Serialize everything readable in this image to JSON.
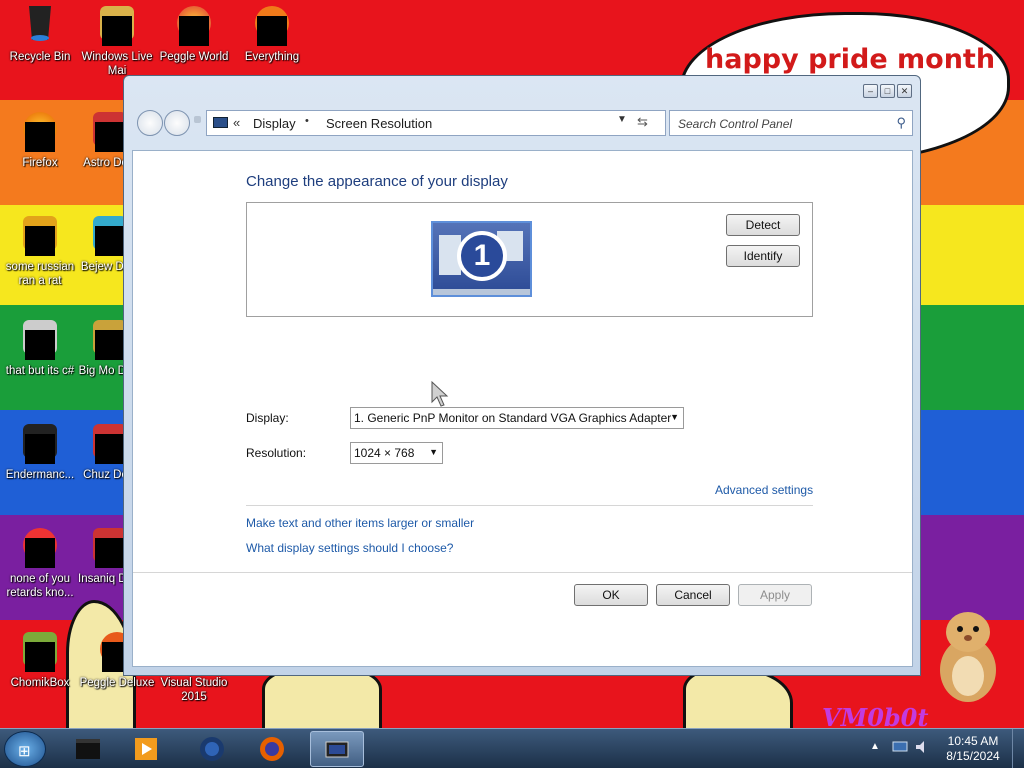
{
  "desktop": {
    "banner": "happy pride month",
    "corner_text": "VM0b0t",
    "icons": [
      {
        "label": "Recycle Bin",
        "icon": "recycle-bin-icon"
      },
      {
        "label": "Windows Live Mai",
        "icon": "mail-icon"
      },
      {
        "label": "Peggle World",
        "icon": "peggle-icon"
      },
      {
        "label": "Everything",
        "icon": "everything-icon"
      },
      {
        "label": "Firefox",
        "icon": "firefox-icon"
      },
      {
        "label": "Astro Delu",
        "icon": "game-icon"
      },
      {
        "label": "some russian ran a rat",
        "icon": "file-icon"
      },
      {
        "label": "Bejew Delu",
        "icon": "bejeweled-icon"
      },
      {
        "label": "that but its c#",
        "icon": "file-icon"
      },
      {
        "label": "Big Mo Delu",
        "icon": "game-icon"
      },
      {
        "label": "Endermanc...",
        "icon": "terminal-icon"
      },
      {
        "label": "Chuz Delu",
        "icon": "game-icon"
      },
      {
        "label": "none of you retards kno...",
        "icon": "app-icon"
      },
      {
        "label": "Insaniq Delu",
        "icon": "game-icon"
      },
      {
        "label": "ChomikBox",
        "icon": "chomikbox-icon"
      },
      {
        "label": "Peggle Deluxe",
        "icon": "peggle-icon"
      },
      {
        "label": "Visual Studio 2015",
        "icon": "visual-studio-icon"
      }
    ]
  },
  "window": {
    "breadcrumb": [
      "Display",
      "Screen Resolution"
    ],
    "breadcrumb_chevron": "«",
    "breadcrumb_sep": "•",
    "search_placeholder": "Search Control Panel",
    "heading": "Change the appearance of your display",
    "monitor_number": "1",
    "detect_label": "Detect",
    "identify_label": "Identify",
    "display_label": "Display:",
    "display_value": "1. Generic PnP Monitor on Standard VGA Graphics Adapter",
    "resolution_label": "Resolution:",
    "resolution_value": "1024 × 768",
    "advanced_link": "Advanced settings",
    "link_larger": "Make text and other items larger or smaller",
    "link_choose": "What display settings should I choose?",
    "ok_label": "OK",
    "cancel_label": "Cancel",
    "apply_label": "Apply"
  },
  "taskbar": {
    "time": "10:45 AM",
    "date": "8/15/2024",
    "pinned": [
      "terminal-icon",
      "media-player-icon",
      "windows-media-center-icon",
      "firefox-icon",
      "display-settings-icon"
    ]
  }
}
